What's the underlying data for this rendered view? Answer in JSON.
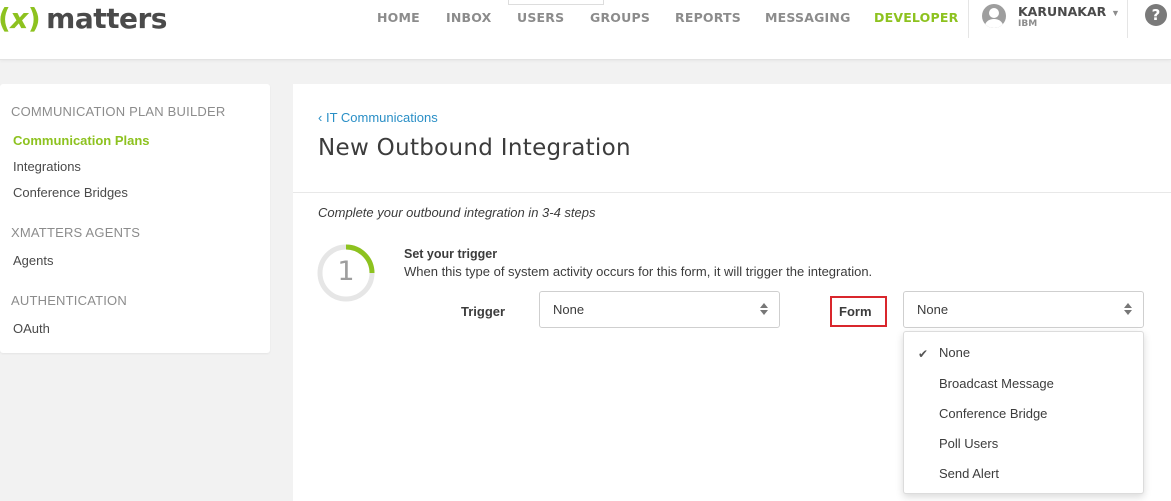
{
  "header": {
    "logo": {
      "paren_open": "(",
      "x": "x",
      "paren_close": ")",
      "word": "matters"
    },
    "nav": [
      "HOME",
      "INBOX",
      "USERS",
      "GROUPS",
      "REPORTS",
      "MESSAGING",
      "DEVELOPER"
    ],
    "active_nav": "DEVELOPER",
    "user": {
      "name": "KARUNAKAR",
      "org": "IBM"
    },
    "help": "?"
  },
  "sidebar": {
    "sections": [
      {
        "heading": "COMMUNICATION PLAN BUILDER",
        "items": [
          "Communication Plans",
          "Integrations",
          "Conference Bridges"
        ]
      },
      {
        "heading": "XMATTERS AGENTS",
        "items": [
          "Agents"
        ]
      },
      {
        "heading": "AUTHENTICATION",
        "items": [
          "OAuth"
        ]
      }
    ],
    "active_item": "Communication Plans"
  },
  "main": {
    "breadcrumb": "IT Communications",
    "breadcrumb_chevron": "‹",
    "title": "New Outbound Integration",
    "instruction": "Complete your outbound integration in 3-4 steps",
    "step": {
      "number": "1",
      "title": "Set your trigger",
      "description": "When this type of system activity occurs for this form, it will trigger the integration."
    },
    "trigger": {
      "label": "Trigger",
      "value": "None"
    },
    "form": {
      "label": "Form",
      "value": "None",
      "options": [
        "None",
        "Broadcast Message",
        "Conference Bridge",
        "Poll Users",
        "Send Alert"
      ],
      "selected": "None"
    }
  },
  "colors": {
    "accent_green": "#8dc21f",
    "link_blue": "#2a8fc6",
    "highlight_red": "#d9262c"
  },
  "icons": [
    "user-avatar-icon",
    "chevron-down-icon",
    "help-icon",
    "chevron-left-icon",
    "checkmark-icon",
    "select-arrows-icon"
  ]
}
